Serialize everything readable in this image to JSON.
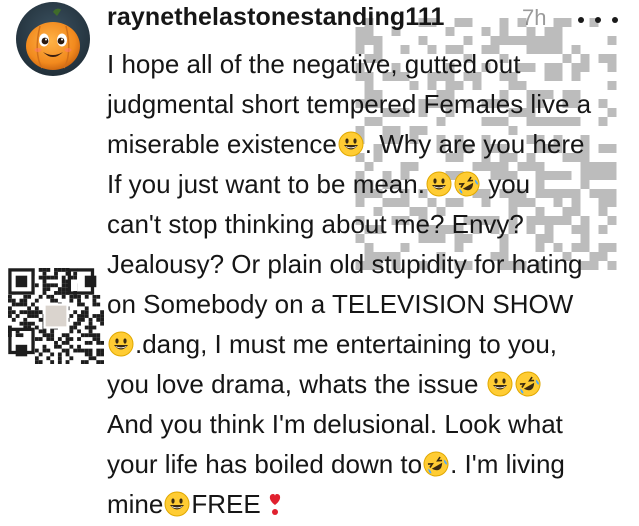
{
  "comment": {
    "username": "raynethelastonestanding111",
    "timestamp": "7h",
    "more_icon": "more-horizontal-icon",
    "avatar_icon": "pumpkin-avatar",
    "lines": [
      {
        "parts": [
          {
            "t": "text",
            "v": "I hope all of the negative, gutted out"
          }
        ]
      },
      {
        "parts": [
          {
            "t": "text",
            "v": "judgmental short tempered Females live a"
          }
        ]
      },
      {
        "parts": [
          {
            "t": "text",
            "v": "miserable existence"
          },
          {
            "t": "emoji",
            "v": "grinning-face-icon"
          },
          {
            "t": "text",
            "v": ". Why are you here"
          }
        ]
      },
      {
        "parts": [
          {
            "t": "text",
            "v": "If you just want to be mean."
          },
          {
            "t": "emoji",
            "v": "grinning-face-icon"
          },
          {
            "t": "emoji",
            "v": "rolling-laughing-face-icon"
          },
          {
            "t": "text",
            "v": " you"
          }
        ]
      },
      {
        "parts": [
          {
            "t": "text",
            "v": "can't stop thinking about me? Envy?"
          }
        ]
      },
      {
        "parts": [
          {
            "t": "text",
            "v": "Jealousy? Or plain old stupidity for hating"
          }
        ]
      },
      {
        "parts": [
          {
            "t": "text",
            "v": "on Somebody on a TELEVISION SHOW"
          }
        ]
      },
      {
        "parts": [
          {
            "t": "emoji",
            "v": "grinning-face-icon"
          },
          {
            "t": "text",
            "v": ".dang, I must me entertaining to you,"
          }
        ]
      },
      {
        "parts": [
          {
            "t": "text",
            "v": "you love drama, whats the issue "
          },
          {
            "t": "emoji",
            "v": "grinning-face-icon"
          },
          {
            "t": "emoji",
            "v": "rolling-laughing-face-icon"
          }
        ]
      },
      {
        "parts": [
          {
            "t": "text",
            "v": "And you think I'm delusional. Look what"
          }
        ]
      },
      {
        "parts": [
          {
            "t": "text",
            "v": "your life has boiled down to"
          },
          {
            "t": "emoji",
            "v": "rolling-laughing-face-icon"
          },
          {
            "t": "text",
            "v": ". I'm living"
          }
        ]
      },
      {
        "parts": [
          {
            "t": "text",
            "v": "mine"
          },
          {
            "t": "emoji",
            "v": "grinning-face-icon"
          },
          {
            "t": "text",
            "v": "FREE"
          },
          {
            "t": "emoji",
            "v": "red-heart-exclamation-icon"
          }
        ]
      }
    ]
  },
  "colors": {
    "text": "#161616",
    "timestamp": "#9a9a9a",
    "emoji_yellow": "#FFCC33",
    "heart_red": "#E0202E",
    "pumpkin_orange": "#F28A1E"
  }
}
